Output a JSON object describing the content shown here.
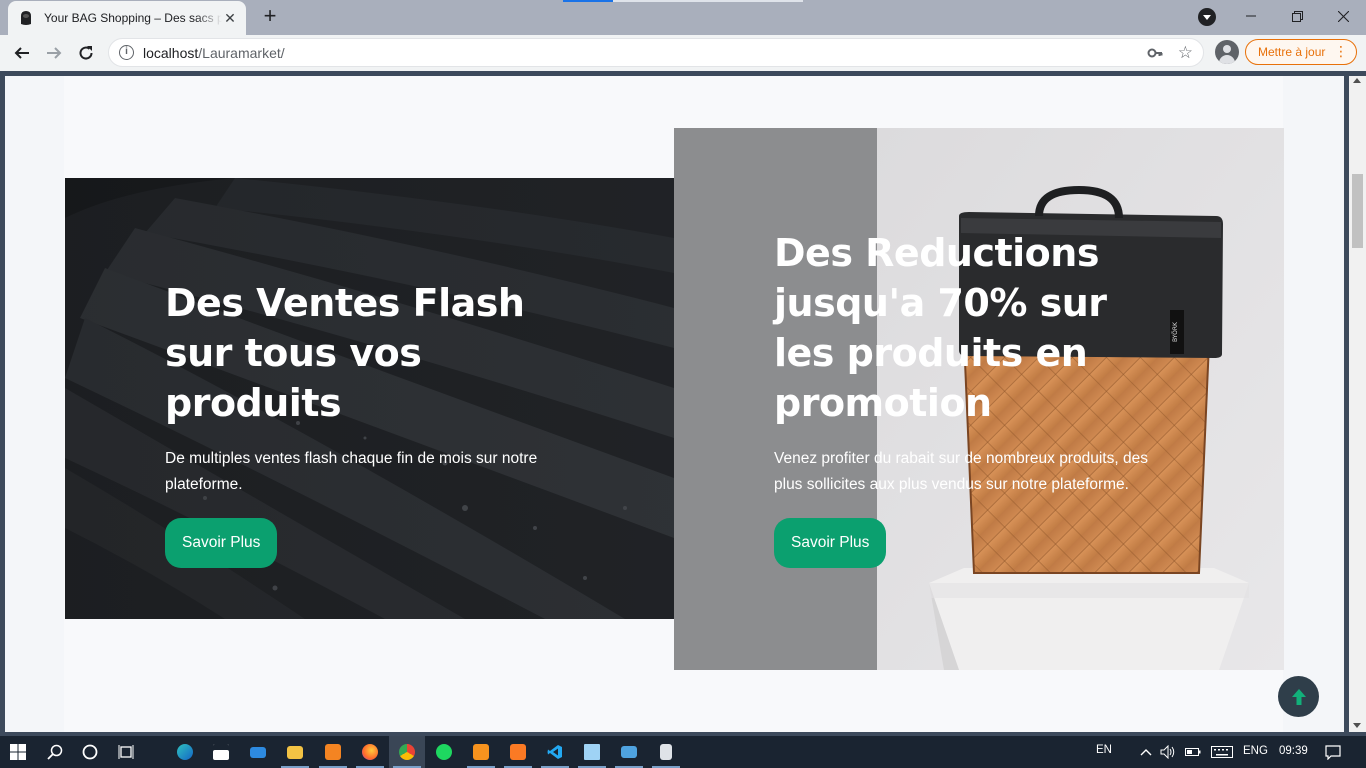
{
  "browser": {
    "tab_title": "Your BAG Shopping – Des sacs pour tous",
    "url_host": "localhost",
    "url_path": "/Lauramarket/",
    "update_label": "Mettre à jour"
  },
  "page": {
    "cards": [
      {
        "title": "Des Ventes Flash sur tous vos produits",
        "description": "De multiples ventes flash chaque fin de mois sur notre plateforme.",
        "button": "Savoir Plus"
      },
      {
        "title": "Des Reductions jusqu'a 70% sur les produits en promotion",
        "description": "Venez profiter du rabait sur de nombreux produits, des plus sollicites aux plus vendus sur notre plateforme.",
        "button": "Savoir Plus",
        "bag_label": "BYÖRK"
      }
    ],
    "accent_color": "#0ba06f"
  },
  "taskbar": {
    "language_short": "EN",
    "language": "ENG",
    "time": "09:39"
  }
}
